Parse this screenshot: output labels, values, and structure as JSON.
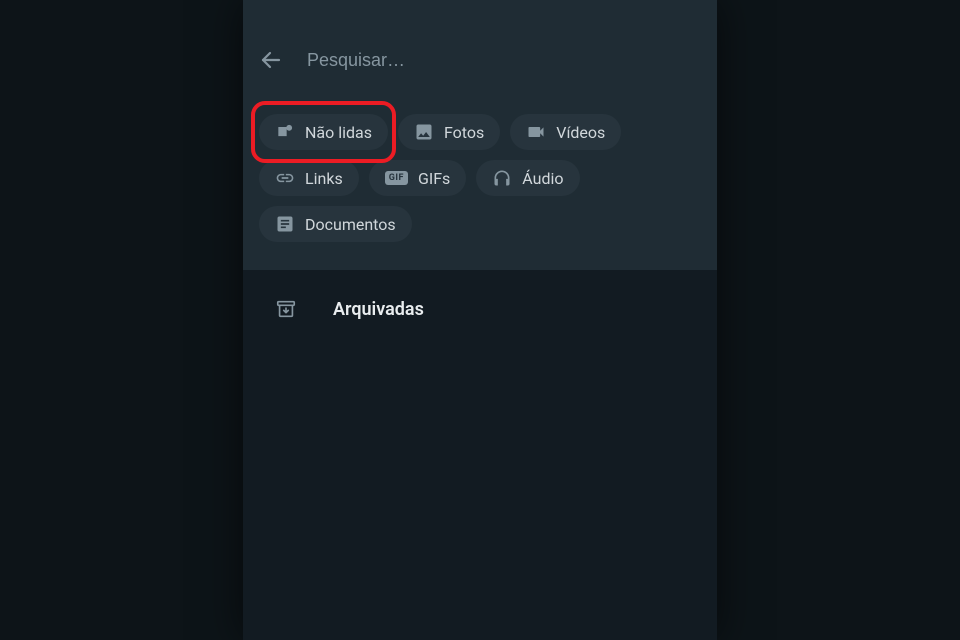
{
  "search": {
    "placeholder": "Pesquisar…"
  },
  "chips": {
    "unread": "Não lidas",
    "photos": "Fotos",
    "videos": "Vídeos",
    "links": "Links",
    "gifs": "GIFs",
    "gif_badge": "GIF",
    "audio": "Áudio",
    "documents": "Documentos"
  },
  "results": {
    "archived": "Arquivadas"
  },
  "colors": {
    "highlight": "#ec1c24",
    "bg_dark": "#121b22",
    "bg_header": "#1f2c34",
    "chip_bg": "#27343d",
    "text_primary": "#e9edef",
    "text_secondary": "#8696a0"
  }
}
